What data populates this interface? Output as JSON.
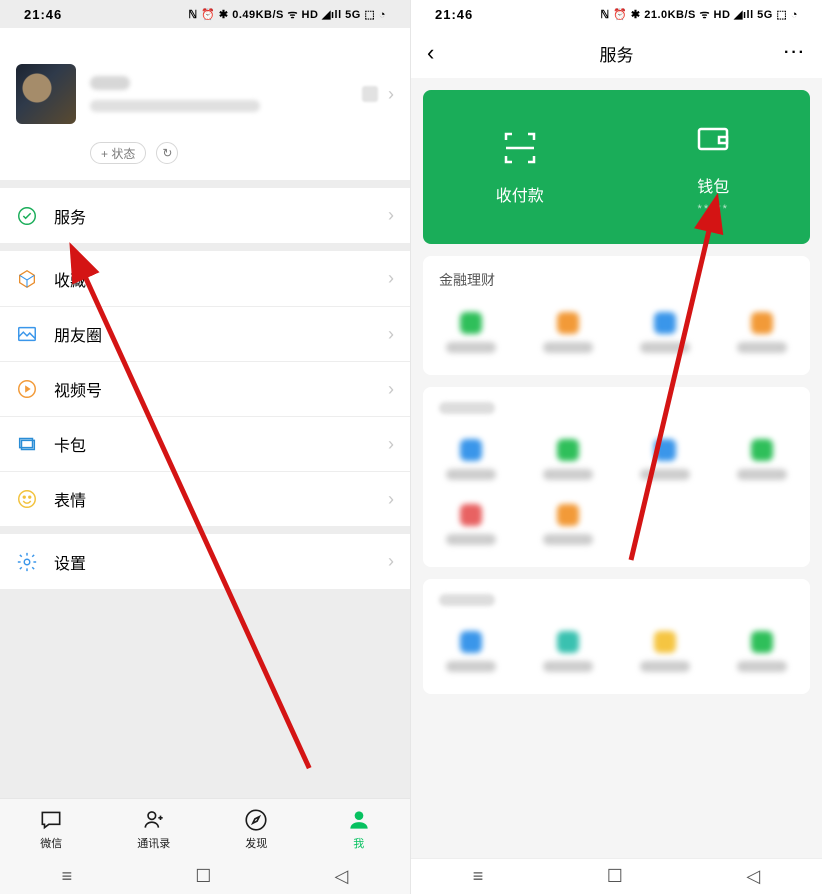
{
  "left": {
    "statusbar": {
      "time": "21:46",
      "icons_text": "ℕ ⏰ ✱ 0.49KB/S ᯤ HD ◢ıll 5G ⬚ ◔"
    },
    "status_pill": "+ 状态",
    "cells": {
      "services": "服务",
      "favorites": "收藏",
      "moments": "朋友圈",
      "channels": "视频号",
      "cards": "卡包",
      "stickers": "表情",
      "settings": "设置"
    },
    "nav": {
      "chats": "微信",
      "contacts": "通讯录",
      "discover": "发现",
      "me": "我"
    }
  },
  "right": {
    "statusbar": {
      "time": "21:46",
      "icons_text": "ℕ ⏰ ✱ 21.0KB/S ᯤ HD ◢ıll 5G ⬚ ◔"
    },
    "header": {
      "title": "服务",
      "more": "···"
    },
    "green": {
      "pay": "收付款",
      "wallet": "钱包",
      "wallet_mask": "*****"
    },
    "section1_title": "金融理财"
  }
}
